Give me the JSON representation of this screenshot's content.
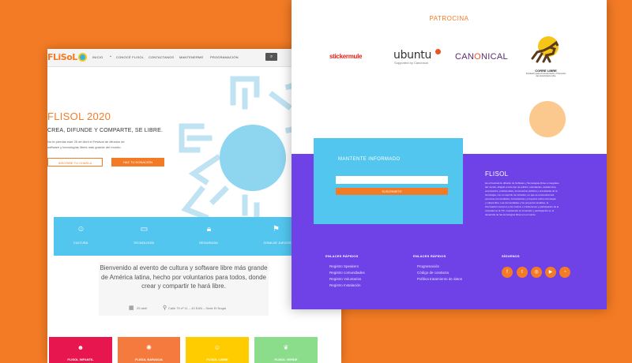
{
  "left_page": {
    "logo": "FLiSoL",
    "nav_items": [
      "INICIO",
      "CONOCÉ FLISOL",
      "CONTACTANOS",
      "MANTENERME",
      "PROGRAMACIÓN"
    ],
    "nav_chevron": "chevron-down-icon",
    "search_icon": "search-icon",
    "hero": {
      "title": "FLISOL 2020",
      "subtitle": "CREA, DIFUNDE Y COMPARTE, SE LIBRE.",
      "description_lines": [
        "No te pierdas este 25 de Abril el Festival de difusión de",
        "software y tecnologías libres más grande del mundo."
      ],
      "primary_button": "INSCRIBE TU CHARLA",
      "secondary_button": "HAZ TU DONACIÓN"
    },
    "features": [
      {
        "icon": "culture-icon",
        "label": "CULTURA"
      },
      {
        "icon": "monitor-icon",
        "label": "TECNOLOGÍA"
      },
      {
        "icon": "lock-icon",
        "label": "SEGURIDAD"
      },
      {
        "icon": "community-icon",
        "label": "ZONA DE JUEGOS"
      }
    ],
    "welcome_text": "Bienvenido al evento de cultura y software libre más grande de América latina, hecho por voluntarios para todos, donde crear y compartir te hará libre.",
    "event_date": "25 abril",
    "event_location": "Calle 79 nº 11 – 43 EAN – Sede El Nogal",
    "cards": [
      {
        "label": "FLISOL INFANTIL",
        "color": "#e8164f",
        "icon": "kids-icon"
      },
      {
        "label": "FLISOL NARANJA",
        "color": "#f47b3d",
        "icon": "sun-icon"
      },
      {
        "label": "FLISOL LIBRE",
        "color": "#ffcc00",
        "icon": "people-icon"
      },
      {
        "label": "FLISOL VERDE",
        "color": "#8bdc8b",
        "icon": "leaf-icon"
      }
    ]
  },
  "right_page": {
    "sponsors_title": "PATROCINA",
    "sponsors": {
      "stickermule": "stickermule",
      "ubuntu": "ubuntu",
      "ubuntu_sub": "Supported by Canonical",
      "canonical_pre": "CAN",
      "canonical_o": "O",
      "canonical_post": "NICAL",
      "correlibre": "CORRE LIBRE",
      "correlibre_sub1": "Fundación para el Conocimiento y Promoción",
      "correlibre_sub2": "del conocimiento Libre"
    },
    "newsletter": {
      "title": "MANTENTE INFORMADO",
      "input_placeholder": "",
      "button": "SUSCRIBETE"
    },
    "about": {
      "title": "FLISOL",
      "paragraph_lines": [
        "Es el Festival de difusión de Software y Tecnologías libres e integrales",
        "del mundo, dirigido a todo tipo de público: estudiantes, académicos,",
        "empresarios, profesionales, funcionarios públicos y entusiastas de la",
        "tecnología, con un espíritu de inclusión, en que se encuentran las",
        "personas comunidades, herramientas y proyectos sobre tecnología",
        "y cultura libre. Las comunidades y los proyectos amables, la",
        "información consumo a los nativos e instituciones y participación de la",
        "sociedad en la TIC, impulsando su inmersión y participación en el",
        "desarrollo de las tecnologías libres en el mundo."
      ]
    },
    "footer": {
      "quick_links_1": {
        "title": "ENLACES RÁPIDOS",
        "items": [
          "Registro Speakers",
          "Registro comunidades",
          "Registro Voluntarios",
          "Registro Instalación"
        ]
      },
      "quick_links_2": {
        "title": "ENLACES RÁPIDOS",
        "items": [
          "Programación",
          "Código de conducta",
          "Política tratamiento de datos"
        ]
      },
      "social": {
        "title": "SÍGUENOS",
        "icons": [
          "facebook-icon",
          "twitter-icon",
          "instagram-icon",
          "youtube-icon",
          "rss-icon"
        ]
      }
    }
  },
  "colors": {
    "background": "#f47b25",
    "accent_orange": "#f47b25",
    "light_blue": "#52c6ef",
    "purple": "#6e42e6",
    "peach": "#fbc98e"
  }
}
